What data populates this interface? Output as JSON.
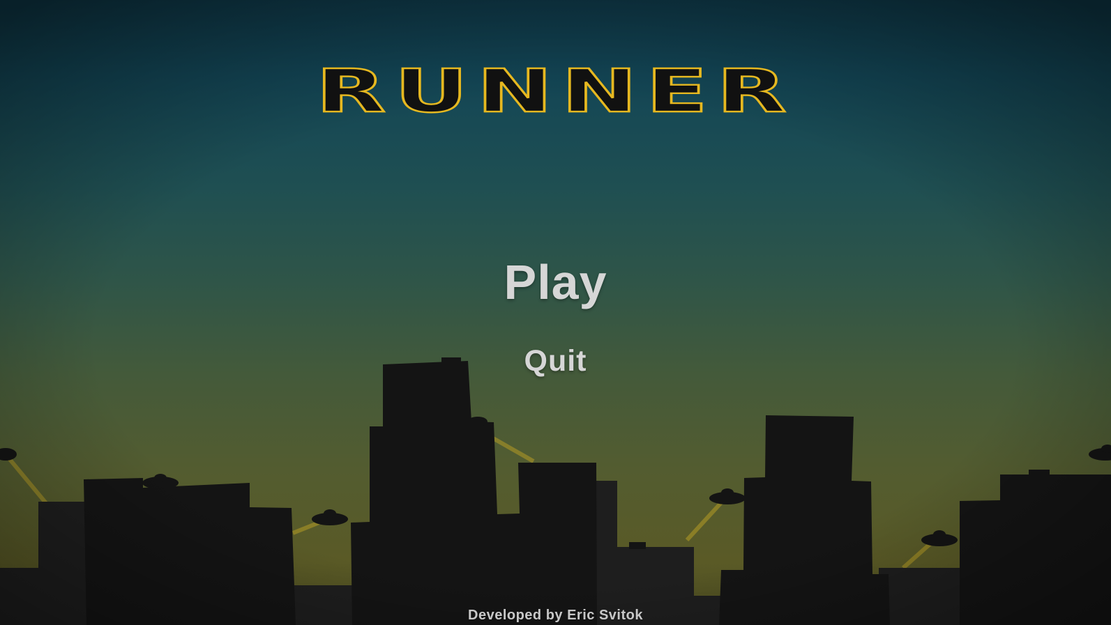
{
  "game": {
    "title": "RUNNER",
    "menu": {
      "play_label": "Play",
      "quit_label": "Quit"
    },
    "credit": "Developed by Eric Svitok"
  },
  "colors": {
    "title_outline": "#e6b820",
    "title_fill": "#111111",
    "menu_text": "#d6d6d6",
    "silhouette": "#141414",
    "background_far": "#1e1e1e",
    "beam": "#b59a25"
  }
}
